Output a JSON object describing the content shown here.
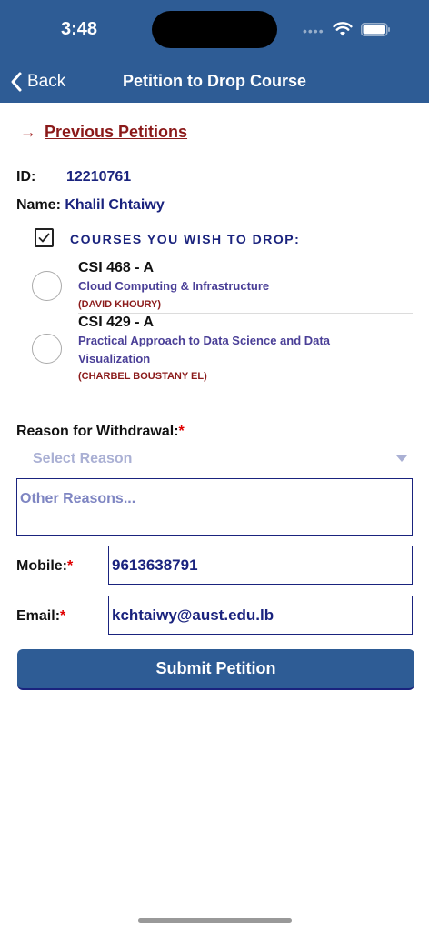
{
  "status_bar": {
    "time": "3:48",
    "signal_dots": "••••"
  },
  "nav": {
    "back_label": "Back",
    "title": "Petition to Drop Course"
  },
  "previous_petitions": {
    "arrow": "→",
    "label": "Previous Petitions"
  },
  "student": {
    "id_label": "ID:",
    "id_value": "12210761",
    "name_label": "Name:",
    "name_value": "Khalil Chtaiwy"
  },
  "courses": {
    "heading": "COURSES YOU WISH TO DROP:",
    "select_all_checked": true,
    "items": [
      {
        "code": "CSI 468 - A",
        "name": "Cloud Computing & Infrastructure",
        "instructor": "(DAVID KHOURY)",
        "selected": false
      },
      {
        "code": "CSI 429 - A",
        "name": "Practical Approach to Data Science and Data Visualization",
        "instructor": "(CHARBEL BOUSTANY EL)",
        "selected": false
      }
    ]
  },
  "reason": {
    "label": "Reason for Withdrawal:",
    "required_mark": "*",
    "select_placeholder": "Select Reason",
    "other_placeholder": "Other Reasons..."
  },
  "mobile": {
    "label": "Mobile:",
    "required_mark": "*",
    "value": "9613638791"
  },
  "email": {
    "label": "Email:",
    "required_mark": "*",
    "value": "kchtaiwy@aust.edu.lb"
  },
  "submit_label": "Submit Petition",
  "colors": {
    "header": "#2e5c95",
    "accent_navy": "#1a237e",
    "link_red": "#8b1a1a",
    "required_red": "#e00000"
  }
}
